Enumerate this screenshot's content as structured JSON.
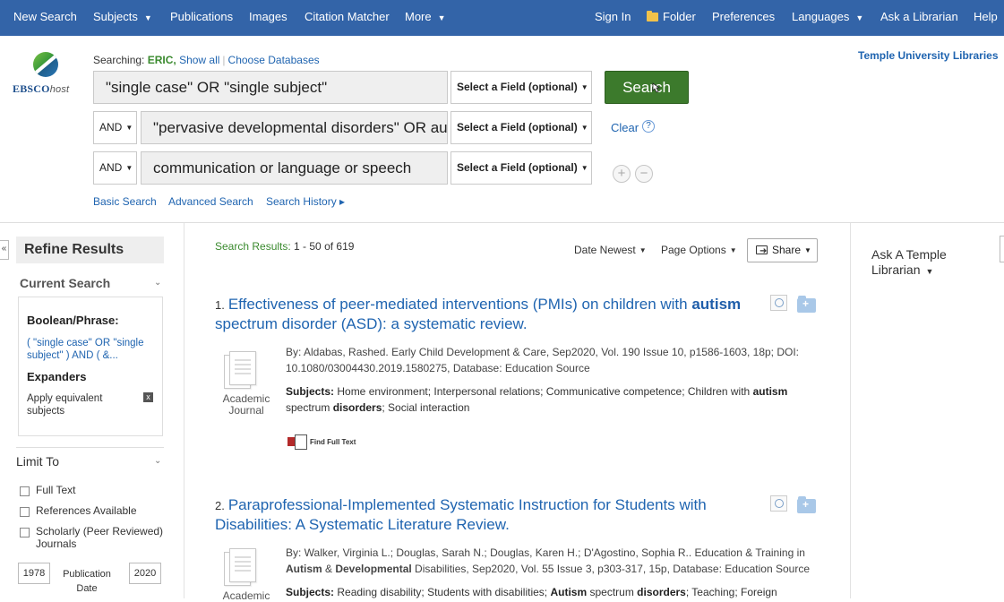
{
  "nav": {
    "new_search": "New Search",
    "subjects": "Subjects",
    "publications": "Publications",
    "images": "Images",
    "citation_matcher": "Citation Matcher",
    "more": "More",
    "sign_in": "Sign In",
    "folder": "Folder",
    "preferences": "Preferences",
    "languages": "Languages",
    "ask_librarian": "Ask a Librarian",
    "help": "Help"
  },
  "logo": {
    "brand": "EBSCO",
    "suffix": "host"
  },
  "searching": {
    "prefix": "Searching: ",
    "database": "ERIC,",
    "show_all": "Show all",
    "choose_databases": "Choose Databases"
  },
  "search_rows": [
    {
      "operator": "",
      "query": "\"single case\" OR \"single subject\"",
      "field": "Select a Field (optional)"
    },
    {
      "operator": "AND",
      "query": "\"pervasive developmental disorders\" OR au",
      "field": "Select a Field (optional)"
    },
    {
      "operator": "AND",
      "query": "communication or language or speech",
      "field": "Select a Field (optional)"
    }
  ],
  "search_button": "Search",
  "clear": "Clear",
  "help_symbol": "?",
  "add_row": "+",
  "remove_row": "−",
  "links": {
    "basic_search": "Basic Search",
    "advanced_search": "Advanced Search",
    "search_history": "Search History ▸"
  },
  "institution": "Temple University Libraries",
  "refine": {
    "title": "Refine Results",
    "collapse_symbol": "«",
    "current_search": "Current Search",
    "boolean_phrase_label": "Boolean/Phrase:",
    "boolean_phrase_value": "( \"single case\" OR \"single subject\" ) AND ( &...",
    "expanders_label": "Expanders",
    "apply_equivalent": "Apply equivalent subjects",
    "remove_symbol": "x",
    "limit_to": "Limit To",
    "limits": [
      "Full Text",
      "References Available",
      "Scholarly (Peer Reviewed) Journals"
    ],
    "date_from": "1978",
    "date_to": "2020",
    "pub_date_label": "Publication Date"
  },
  "results_header": {
    "label": "Search Results:",
    "range": "1 - 50 of 619",
    "sort": "Date Newest",
    "page_options": "Page Options",
    "share": "Share"
  },
  "results": [
    {
      "number": "1.",
      "title_before": "Effectiveness of peer-mediated interventions (PMIs) on children with ",
      "title_bold": "autism",
      "title_after": " spectrum disorder (ASD): a systematic review.",
      "meta": "By: Aldabas, Rashed. Early Child Development & Care, Sep2020, Vol. 190 Issue 10, p1586-1603, 18p; DOI: 10.1080/03004430.2019.1580275, Database: Education Source",
      "subjects_label": "Subjects:",
      "subjects_a": " Home environment; Interpersonal relations; Communicative competence; Children with ",
      "subjects_b1": "autism",
      "subjects_c": " spectrum ",
      "subjects_b2": "disorders",
      "subjects_d": "; Social interaction",
      "type": "Academic Journal",
      "full_text": "Find Full Text"
    },
    {
      "number": "2.",
      "title": "Paraprofessional-Implemented Systematic Instruction for Students with Disabilities: A Systematic Literature Review.",
      "meta_a": "By: Walker, Virginia L.; Douglas, Sarah N.; Douglas, Karen H.; D'Agostino, Sophia R.. Education & Training in ",
      "meta_b1": "Autism",
      "meta_c": " & ",
      "meta_b2": "Developmental",
      "meta_d": " Disabilities, Sep2020, Vol. 55 Issue 3, p303-317, 15p, Database: Education Source",
      "subjects_label": "Subjects:",
      "subjects_a": " Reading disability; Students with disabilities; ",
      "subjects_b1": "Autism",
      "subjects_c": " spectrum ",
      "subjects_b2": "disorders",
      "subjects_d": "; Teaching; Foreign",
      "type": "Academic"
    }
  ],
  "right_panel": {
    "ask": "Ask A Temple Librarian"
  }
}
